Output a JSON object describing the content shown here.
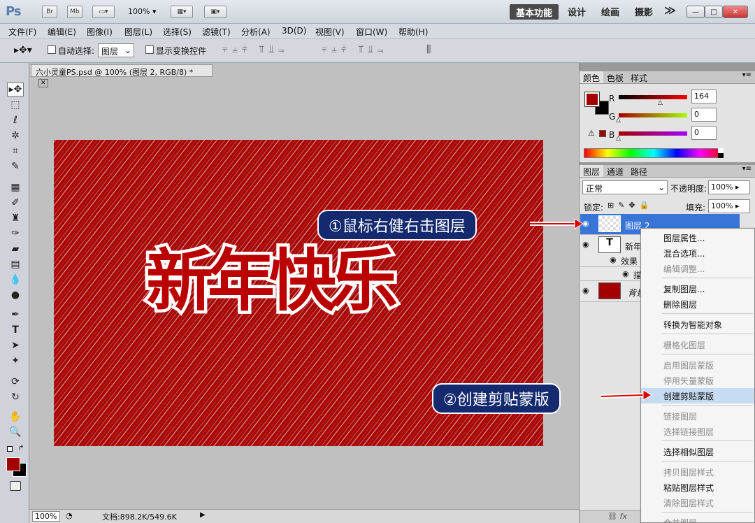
{
  "titlebar": {
    "logo": "Ps",
    "br_btn": "Br",
    "mb_btn": "Mb",
    "zoom": "100%",
    "workspaces": [
      "基本功能",
      "设计",
      "绘画",
      "摄影"
    ],
    "more": "≫",
    "window_buttons": [
      "—",
      "□",
      "✕"
    ]
  },
  "menubar": {
    "items": [
      "文件(F)",
      "编辑(E)",
      "图像(I)",
      "图层(L)",
      "选择(S)",
      "滤镜(T)",
      "分析(A)",
      "3D(D)",
      "视图(V)",
      "窗口(W)",
      "帮助(H)"
    ]
  },
  "options": {
    "auto_select_label": "自动选择:",
    "auto_select_value": "图层",
    "show_transform_label": "显示变换控件"
  },
  "document": {
    "tab_title": "六小灵童PS.psd @ 100% (图层 2, RGB/8) *",
    "canvas_text": "新年快乐",
    "zoom": "100%",
    "doc_info": "文档:898.2K/549.6K"
  },
  "color_panel": {
    "tabs": [
      "颜色",
      "色板",
      "样式"
    ],
    "channels": [
      {
        "name": "R",
        "value": "164",
        "color": "#c00000",
        "fraction": 0.643
      },
      {
        "name": "G",
        "value": "0",
        "color": "#9acd32",
        "fraction": 0
      },
      {
        "name": "B",
        "value": "0",
        "color": "#a020c0",
        "fraction": 0
      }
    ],
    "foreground": "#a40000",
    "background": "#000000"
  },
  "layers_panel": {
    "tabs": [
      "图层",
      "通道",
      "路径"
    ],
    "blend_mode": "正常",
    "opacity_label": "不透明度:",
    "opacity": "100%",
    "lock_label": "锁定:",
    "fill_label": "填充:",
    "fill": "100%",
    "layers": [
      {
        "name": "图层 2",
        "selected": true
      },
      {
        "name": "新年",
        "type": "text"
      },
      {
        "name": "效果"
      },
      {
        "name": "描"
      },
      {
        "name": "背景"
      }
    ]
  },
  "context_menu": {
    "items": [
      {
        "label": "图层属性...",
        "disabled": false
      },
      {
        "label": "混合选项...",
        "disabled": false
      },
      {
        "label": "编辑调整...",
        "disabled": true
      },
      {
        "label": "复制图层...",
        "disabled": false
      },
      {
        "label": "删除图层",
        "disabled": false
      },
      {
        "label": "转换为智能对象",
        "disabled": false
      },
      {
        "label": "栅格化图层",
        "disabled": true
      },
      {
        "label": "启用图层蒙版",
        "disabled": true
      },
      {
        "label": "停用矢量蒙版",
        "disabled": true
      },
      {
        "label": "创建剪贴蒙版",
        "disabled": false,
        "highlighted": true
      },
      {
        "label": "链接图层",
        "disabled": true
      },
      {
        "label": "选择链接图层",
        "disabled": true
      },
      {
        "label": "选择相似图层",
        "disabled": false
      },
      {
        "label": "拷贝图层样式",
        "disabled": true
      },
      {
        "label": "粘贴图层样式",
        "disabled": false
      },
      {
        "label": "清除图层样式",
        "disabled": true
      },
      {
        "label": "合并图层",
        "disabled": true
      }
    ]
  },
  "annotations": {
    "step1": "①鼠标右健右击图层",
    "step2": "②创建剪贴蒙版"
  }
}
